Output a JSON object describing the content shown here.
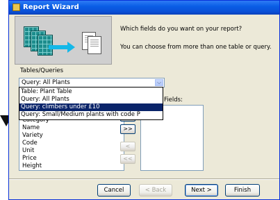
{
  "window": {
    "title": "Report Wizard"
  },
  "intro": {
    "question": "Which fields do you want on your report?",
    "hint": "You can choose from more than one table or query."
  },
  "tables_queries": {
    "label": "Tables/Queries",
    "selected": "Query: All Plants",
    "options": [
      "Table: Plant Table",
      "Query: All Plants",
      "Query: climbers under £10",
      "Query: Small/Medium plants with code P"
    ],
    "highlighted_index": 2
  },
  "available_fields": [
    "Category",
    "Name",
    "Variety",
    "Code",
    "Unit",
    "Price",
    "Height"
  ],
  "selected_fields": {
    "label": "Fields:",
    "items": []
  },
  "move_buttons": {
    "add_all": ">>",
    "remove_one": "<",
    "remove_all": "<<"
  },
  "buttons": {
    "cancel": "Cancel",
    "back": "< Back",
    "next": "Next >",
    "finish": "Finish"
  },
  "colors": {
    "titlebar": "#0a5ee6",
    "highlight": "#0a246a",
    "dialog_bg": "#ece9d8"
  }
}
